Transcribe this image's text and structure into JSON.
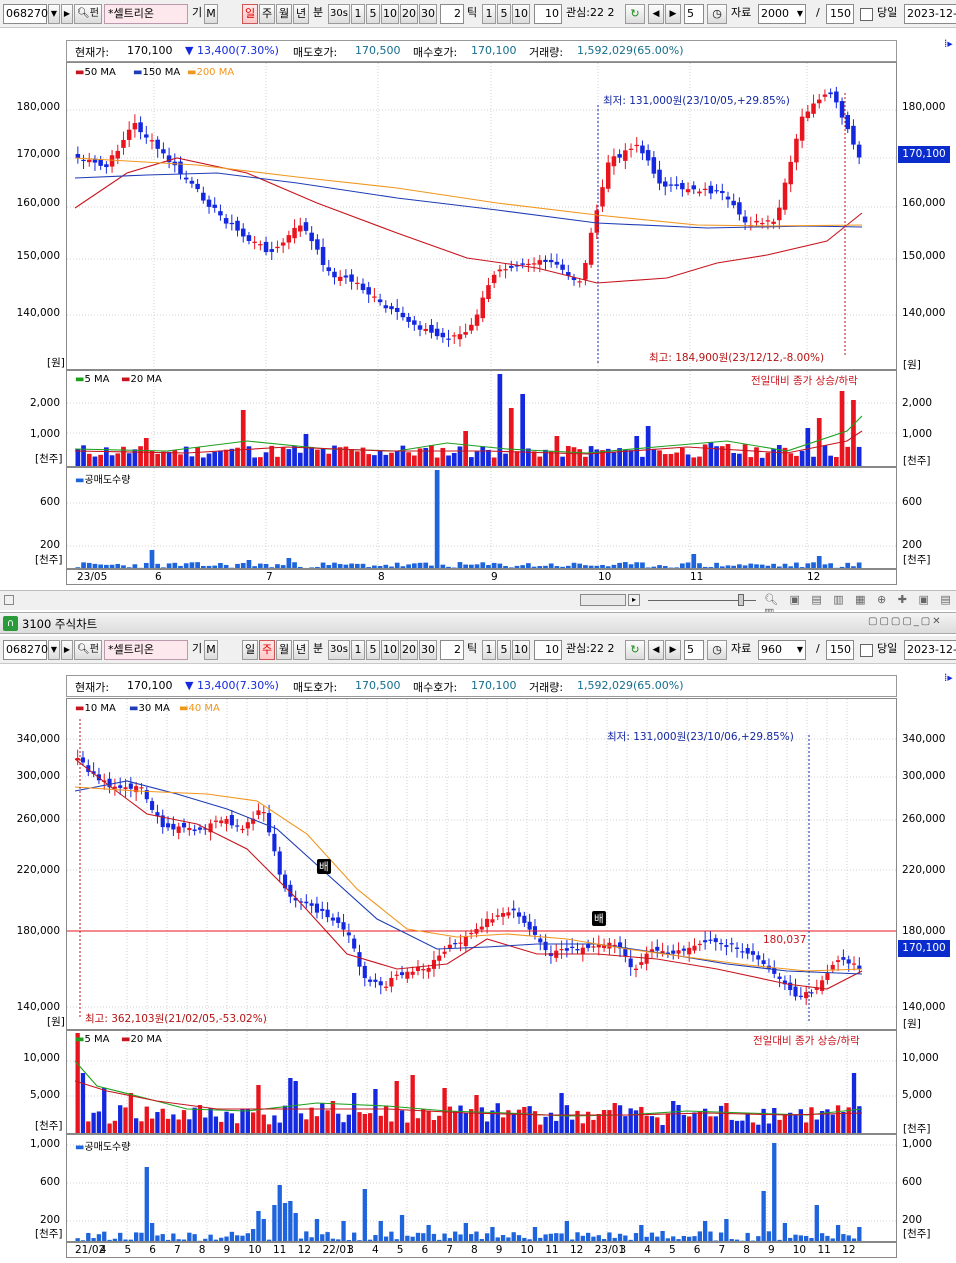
{
  "toolbar_top": {
    "code": "068270",
    "name": "*셀트리온",
    "tag": "기",
    "m": "M",
    "periods": [
      "일",
      "주",
      "월",
      "년",
      "분"
    ],
    "active_period": "일",
    "intervals": [
      "30s",
      "1",
      "5",
      "10",
      "20",
      "30"
    ],
    "tick_value": "2",
    "tick_label": "틱",
    "tick_opts": [
      "1",
      "5",
      "10"
    ],
    "tick_value2": "10",
    "watch": "관심:22 2",
    "num": "5",
    "data_label": "자료",
    "data_value": "2000",
    "slash": "/",
    "count": "150",
    "today": "당일",
    "date": "2023-12-"
  },
  "toolbar_bottom": {
    "code": "068270",
    "name": "*셀트리온",
    "tag": "기",
    "m": "M",
    "periods": [
      "일",
      "주",
      "월",
      "년",
      "분"
    ],
    "active_period": "주",
    "intervals": [
      "30s",
      "1",
      "5",
      "10",
      "20",
      "30"
    ],
    "tick_value": "2",
    "tick_label": "틱",
    "tick_opts": [
      "1",
      "5",
      "10"
    ],
    "tick_value2": "10",
    "watch": "관심:22 2",
    "num": "5",
    "data_label": "자료",
    "data_value": "960",
    "slash": "/",
    "count": "150",
    "today": "당일",
    "date": "2023-12-"
  },
  "info": {
    "cur_label": "현재가:",
    "cur_value": "170,100",
    "change": "▼ 13,400(7.30%)",
    "ask_label": "매도호가:",
    "ask_value": "170,500",
    "bid_label": "매수호가:",
    "bid_value": "170,100",
    "vol_label": "거래량:",
    "vol_value": "1,592,029(65.00%)"
  },
  "window_title": "3100 주식차트",
  "window_icon": "3100-logo-icon",
  "colors": {
    "up": "#e8141e",
    "down": "#1428e0",
    "ma_red": "#c8141e",
    "ma_blue": "#1e3cb4",
    "ma_orange": "#f0961e",
    "green": "#1ea01e",
    "tag_bg": "#0a2ccc"
  },
  "daily": {
    "legend": [
      {
        "label": "50 MA",
        "color": "#c8141e"
      },
      {
        "label": "150 MA",
        "color": "#1e3cb4"
      },
      {
        "label": "200 MA",
        "color": "#f0961e"
      }
    ],
    "y_ticks": [
      "180,000",
      "170,000",
      "160,000",
      "150,000",
      "140,000"
    ],
    "y_unit": "[원]",
    "low_note": "최저: 131,000원(23/10/05,+29.85%)",
    "high_note": "최고: 184,900원(23/12/12,-8.00%)",
    "price_tag": "170,100",
    "vol_legend": [
      {
        "label": "5 MA",
        "color": "#1ea01e"
      },
      {
        "label": "20 MA",
        "color": "#c8141e"
      }
    ],
    "vol_note": "전일대비 종가 상승/하락",
    "vol_ticks": [
      "2,000",
      "1,000"
    ],
    "vol_unit": "[천주]",
    "short_legend": "공매도수량",
    "short_ticks": [
      "600",
      "200"
    ],
    "short_unit": "[천주]",
    "x_labels": [
      "23/05",
      "6",
      "7",
      "8",
      "9",
      "10",
      "11",
      "12"
    ]
  },
  "weekly": {
    "legend": [
      {
        "label": "10 MA",
        "color": "#c8141e"
      },
      {
        "label": "30 MA",
        "color": "#1e3cb4"
      },
      {
        "label": "40 MA",
        "color": "#f0961e"
      }
    ],
    "y_ticks": [
      "340,000",
      "300,000",
      "260,000",
      "220,000",
      "180,000",
      "140,000"
    ],
    "y_unit": "[원]",
    "low_note": "최저: 131,000원(23/10/06,+29.85%)",
    "high_note": "최고: 362,103원(21/02/05,-53.02%)",
    "line_label": "180,037",
    "price_tag": "170,100",
    "vol_legend": [
      {
        "label": "5 MA",
        "color": "#1ea01e"
      },
      {
        "label": "20 MA",
        "color": "#c8141e"
      }
    ],
    "vol_note": "전일대비 종가 상승/하락",
    "vol_ticks": [
      "10,000",
      "5,000"
    ],
    "vol_unit": "[천주]",
    "short_legend": "공매도수량",
    "short_ticks": [
      "1,000",
      "600",
      "200"
    ],
    "short_unit": "[천주]",
    "x_labels": [
      "21/02",
      "4",
      "5",
      "6",
      "7",
      "8",
      "9",
      "10",
      "11",
      "12",
      "22/01",
      "3",
      "4",
      "5",
      "6",
      "7",
      "8",
      "9",
      "10",
      "11",
      "12",
      "23/01",
      "3",
      "4",
      "5",
      "6",
      "7",
      "8",
      "9",
      "10",
      "11",
      "12"
    ],
    "marker": "배"
  }
}
